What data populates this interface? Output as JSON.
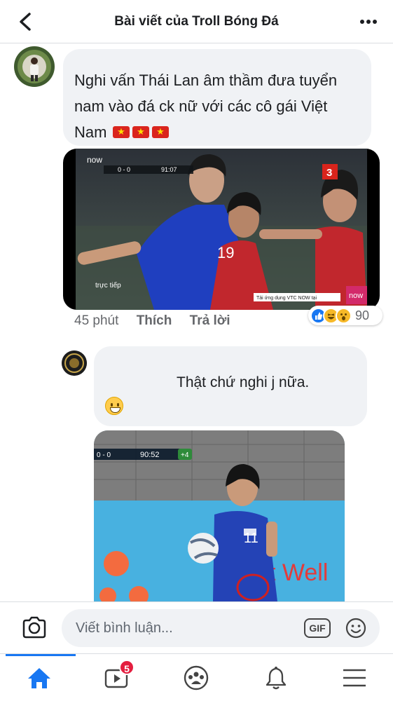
{
  "header": {
    "title": "Bài viết của Troll Bóng Đá"
  },
  "comment1": {
    "text": "Nghi vấn Thái Lan âm thầm đưa tuyển nam vào đá ck nữ với các cô gái Việt Nam",
    "time": "45 phút",
    "like_label": "Thích",
    "reply_label": "Trả lời",
    "reaction_count": "90",
    "reaction_icons": [
      "like-icon",
      "haha-icon",
      "wow-icon"
    ],
    "media": {
      "channel_logo": "now",
      "score": "0 - 0",
      "clock": "91:07",
      "corner_badge": "3",
      "live_label": "trực tiếp",
      "jersey_number": "19",
      "ticker": "Tải ứng dụng VTC NOW tại",
      "corner_logo": "now"
    }
  },
  "comment2": {
    "text": "Thật chứ nghi       j nữa.",
    "emoji": "grinning-face-emoji",
    "media": {
      "score": "0 - 0",
      "clock": "90:52",
      "added_time": "+4",
      "jersey_number": "11",
      "board_text": "t Well"
    }
  },
  "composer": {
    "placeholder": "Viết bình luận...",
    "gif_label": "GIF"
  },
  "tabbar": {
    "watch_badge": "5"
  },
  "colors": {
    "brand": "#1877f2",
    "bubble": "#f0f2f5",
    "badge": "#e41e3f"
  }
}
